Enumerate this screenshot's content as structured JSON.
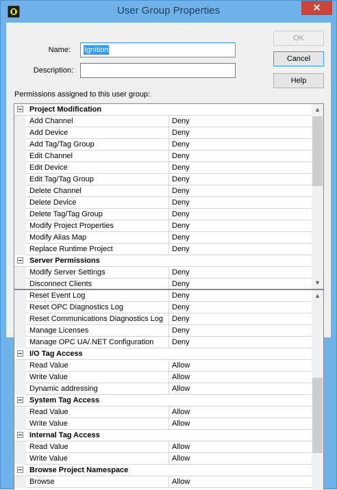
{
  "window": {
    "title": "User Group Properties",
    "close_glyph": "✕"
  },
  "form": {
    "name_label": "Name:",
    "name_value": "Ignition",
    "description_label": "Description:",
    "description_value": "",
    "permissions_label": "Permissions assigned to this user group:"
  },
  "buttons": {
    "ok": "OK",
    "cancel": "Cancel",
    "help": "Help"
  },
  "icons": {
    "app": "app-icon",
    "collapse": "minus-box-icon",
    "scroll_up": "chevron-up-icon",
    "scroll_down": "chevron-down-icon"
  },
  "grid_top": [
    {
      "cat": "Project Modification"
    },
    {
      "name": "Add Channel",
      "value": "Deny"
    },
    {
      "name": "Add Device",
      "value": "Deny"
    },
    {
      "name": "Add Tag/Tag Group",
      "value": "Deny"
    },
    {
      "name": "Edit Channel",
      "value": "Deny"
    },
    {
      "name": "Edit Device",
      "value": "Deny"
    },
    {
      "name": "Edit Tag/Tag Group",
      "value": "Deny"
    },
    {
      "name": "Delete Channel",
      "value": "Deny"
    },
    {
      "name": "Delete Device",
      "value": "Deny"
    },
    {
      "name": "Delete Tag/Tag Group",
      "value": "Deny"
    },
    {
      "name": "Modify Project Properties",
      "value": "Deny"
    },
    {
      "name": "Modify Alias Map",
      "value": "Deny"
    },
    {
      "name": "Replace Runtime Project",
      "value": "Deny"
    },
    {
      "cat": "Server Permissions"
    },
    {
      "name": "Modify Server Settings",
      "value": "Deny"
    },
    {
      "name": "Disconnect Clients",
      "value": "Deny"
    }
  ],
  "grid_bottom": [
    {
      "name": "Reset Event Log",
      "value": "Deny"
    },
    {
      "name": "Reset OPC Diagnostics Log",
      "value": "Deny"
    },
    {
      "name": "Reset Communications Diagnostics Log",
      "value": "Deny"
    },
    {
      "name": "Manage Licenses",
      "value": "Deny"
    },
    {
      "name": "Manage OPC UA/.NET Configuration",
      "value": "Deny"
    },
    {
      "cat": "I/O Tag Access"
    },
    {
      "name": "Read Value",
      "value": "Allow"
    },
    {
      "name": "Write Value",
      "value": "Allow"
    },
    {
      "name": "Dynamic addressing",
      "value": "Allow"
    },
    {
      "cat": "System Tag Access"
    },
    {
      "name": "Read Value",
      "value": "Allow"
    },
    {
      "name": "Write Value",
      "value": "Allow"
    },
    {
      "cat": "Internal Tag Access"
    },
    {
      "name": "Read Value",
      "value": "Allow"
    },
    {
      "name": "Write Value",
      "value": "Allow"
    },
    {
      "cat": "Browse Project Namespace"
    },
    {
      "name": "Browse",
      "value": "Allow"
    }
  ]
}
